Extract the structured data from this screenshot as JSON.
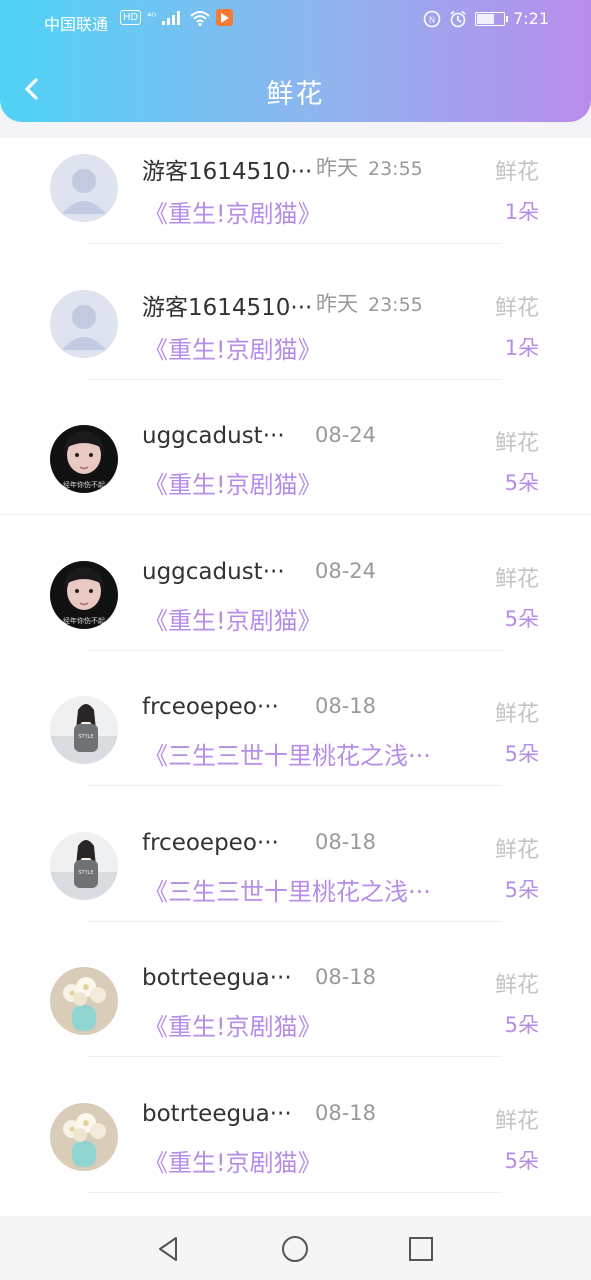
{
  "status_bar": {
    "carrier": "中国联通",
    "hd": "HD",
    "network": "⁴ᴳ",
    "time": "7:21",
    "battery_level": 0.6
  },
  "header": {
    "title": "鲜花",
    "back_icon": "chevron-left-icon"
  },
  "colors": {
    "header_gradient": [
      "#4fd3f5",
      "#8fb4ee",
      "#b98cec"
    ],
    "accent_purple": "#b68de8",
    "muted_gray": "#9a9a9a"
  },
  "rows": [
    {
      "name": "游客1614510···",
      "date": "昨天",
      "clock": "23:55",
      "gift": "鲜花",
      "work": "《重生!京剧猫》",
      "count": "1朵",
      "avatar": "default-avatar"
    },
    {
      "name": "游客1614510···",
      "date": "昨天",
      "clock": "23:55",
      "gift": "鲜花",
      "work": "《重生!京剧猫》",
      "count": "1朵",
      "avatar": "default-avatar"
    },
    {
      "name": "uggcadust···",
      "date": "08-24",
      "clock": "",
      "gift": "鲜花",
      "work": "《重生!京剧猫》",
      "count": "5朵",
      "avatar": "girl-dark-avatar"
    },
    {
      "name": "uggcadust···",
      "date": "08-24",
      "clock": "",
      "gift": "鲜花",
      "work": "《重生!京剧猫》",
      "count": "5朵",
      "avatar": "girl-dark-avatar"
    },
    {
      "name": "frceoepeo···",
      "date": "08-18",
      "clock": "",
      "gift": "鲜花",
      "work": "《三生三世十里桃花之浅···",
      "count": "5朵",
      "avatar": "girl-standing-avatar"
    },
    {
      "name": "frceoepeo···",
      "date": "08-18",
      "clock": "",
      "gift": "鲜花",
      "work": "《三生三世十里桃花之浅···",
      "count": "5朵",
      "avatar": "girl-standing-avatar"
    },
    {
      "name": "botrteegua···",
      "date": "08-18",
      "clock": "",
      "gift": "鲜花",
      "work": "《重生!京剧猫》",
      "count": "5朵",
      "avatar": "flower-vase-avatar"
    },
    {
      "name": "botrteegua···",
      "date": "08-18",
      "clock": "",
      "gift": "鲜花",
      "work": "《重生!京剧猫》",
      "count": "5朵",
      "avatar": "flower-vase-avatar"
    }
  ],
  "nav": {
    "back": "nav-back-triangle-icon",
    "home": "nav-home-circle-icon",
    "recents": "nav-recents-square-icon"
  }
}
